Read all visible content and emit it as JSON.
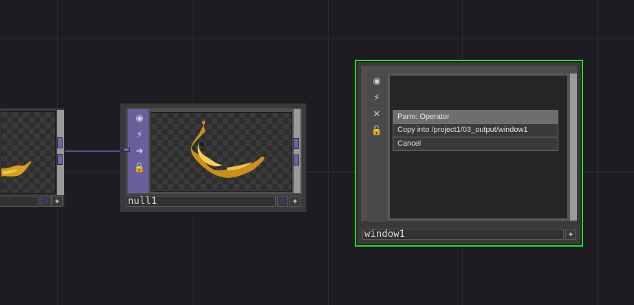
{
  "network": {
    "nodes": [
      {
        "id": "left-node",
        "name": ""
      },
      {
        "id": "null1",
        "name": "null1"
      },
      {
        "id": "window1",
        "name": "window1"
      }
    ]
  },
  "icons": {
    "viewer_active": "◉",
    "bypass": "⚡",
    "display": "➜",
    "close": "✕",
    "lock": "🔓",
    "plus": "✦"
  },
  "context_menu": {
    "header": "Parm: Operator",
    "items": [
      "Copy into /project1/03_output/window1",
      "Cancel"
    ]
  },
  "colors": {
    "selection": "#19e619",
    "wire": "#5b4e9a",
    "flag_strip": "#6a5f9c"
  }
}
